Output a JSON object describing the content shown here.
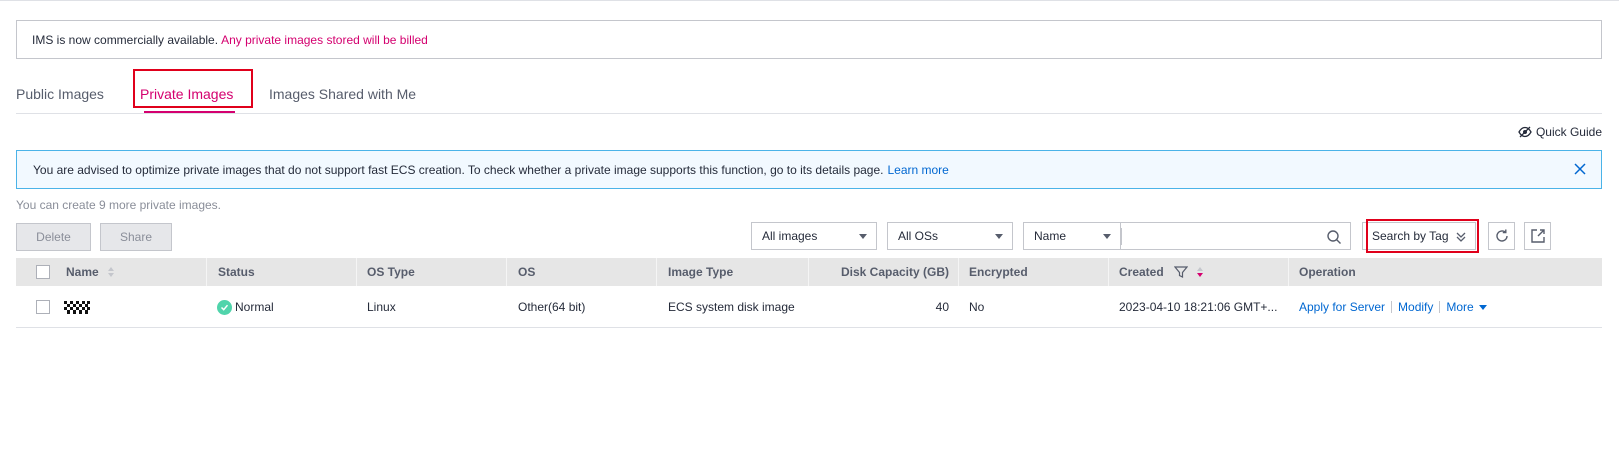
{
  "notice": {
    "text": "IMS is now commercially available.",
    "highlight": "Any private images stored will be billed"
  },
  "tabs": [
    {
      "label": "Public Images",
      "active": false
    },
    {
      "label": "Private Images",
      "active": true
    },
    {
      "label": "Images Shared with Me",
      "active": false
    }
  ],
  "quick_guide": {
    "label": "Quick Guide",
    "icon": "eye-off-icon"
  },
  "info_banner": {
    "text": "You are advised to optimize private images that do not support fast ECS creation. To check whether a private image supports this function, go to its details page.",
    "link": "Learn more"
  },
  "quota_text": "You can create 9 more private images.",
  "toolbar": {
    "delete_label": "Delete",
    "share_label": "Share",
    "image_filter": "All images",
    "os_filter": "All OSs",
    "search_field": "Name",
    "search_value": "",
    "search_by_tag": "Search by Tag"
  },
  "table": {
    "headers": {
      "name": "Name",
      "status": "Status",
      "os_type": "OS Type",
      "os": "OS",
      "image_type": "Image Type",
      "disk_capacity": "Disk Capacity (GB)",
      "encrypted": "Encrypted",
      "created": "Created",
      "operation": "Operation"
    },
    "rows": [
      {
        "name": "",
        "status": "Normal",
        "os_type": "Linux",
        "os": "Other(64 bit)",
        "image_type": "ECS system disk image",
        "disk_capacity": "40",
        "encrypted": "No",
        "created": "2023-04-10 18:21:06 GMT+...",
        "ops": {
          "apply": "Apply for Server",
          "modify": "Modify",
          "more": "More"
        }
      }
    ]
  },
  "colors": {
    "accent": "#d4006f",
    "link": "#0067d1",
    "info_bg": "#f2f9ff",
    "info_border": "#4bb3e8",
    "status_normal": "#50d4ab",
    "highlight_box": "#e0001b"
  }
}
